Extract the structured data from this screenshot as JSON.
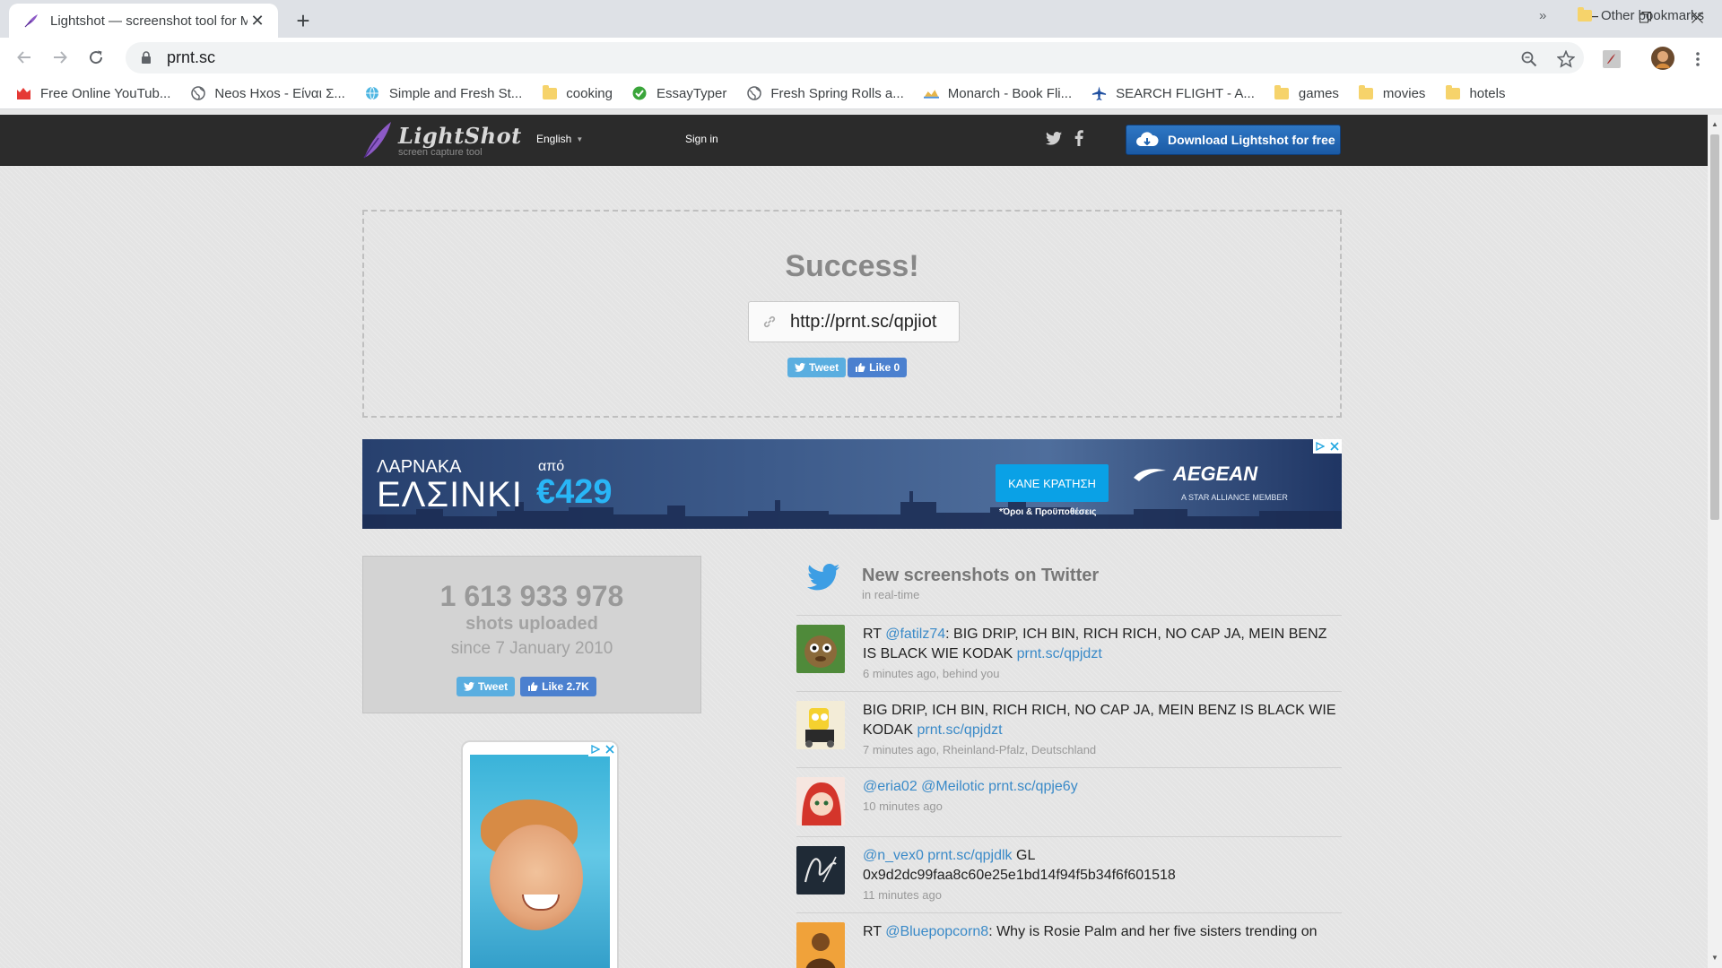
{
  "browser": {
    "tab_title": "Lightshot — screenshot tool for Mac & Win",
    "url": "prnt.sc",
    "bookmarks": [
      {
        "label": "Free Online YouTub...",
        "icon": "youtube-mp3-icon"
      },
      {
        "label": "Neos Hxos - Είναι Σ...",
        "icon": "globe-icon"
      },
      {
        "label": "Simple and Fresh St...",
        "icon": "globe-blue-icon"
      },
      {
        "label": "cooking",
        "icon": "folder-icon"
      },
      {
        "label": "EssayTyper",
        "icon": "check-circle-icon"
      },
      {
        "label": "Fresh Spring Rolls a...",
        "icon": "globe-icon"
      },
      {
        "label": "Monarch - Book Fli...",
        "icon": "monarch-icon"
      },
      {
        "label": "SEARCH FLIGHT - A...",
        "icon": "plane-icon"
      },
      {
        "label": "games",
        "icon": "folder-icon"
      },
      {
        "label": "movies",
        "icon": "folder-icon"
      },
      {
        "label": "hotels",
        "icon": "folder-icon"
      }
    ],
    "bookmarks_more": "»",
    "other_bookmarks": "Other bookmarks"
  },
  "header": {
    "logo_name": "LightShot",
    "logo_tagline": "screen capture tool",
    "language": "English",
    "signin": "Sign in",
    "download": "Download Lightshot for free"
  },
  "upload": {
    "title": "Success!",
    "link": "http://prnt.sc/qpjiot",
    "tweet": "Tweet",
    "like": "Like 0"
  },
  "ad": {
    "from_city": "ΛΑΡΝΑΚΑ",
    "to_city": "ΕΛΣΙΝΚΙ",
    "price_prefix": "από",
    "price": "€429",
    "cta": "ΚΑΝΕ ΚΡΑΤΗΣΗ",
    "terms": "*Όροι & Προϋποθέσεις",
    "brand": "AEGEAN",
    "alliance": "A STAR ALLIANCE MEMBER"
  },
  "stats": {
    "count": "1 613 933 978",
    "label": "shots uploaded",
    "since": "since 7 January 2010",
    "tweet": "Tweet",
    "like": "Like 2.7K"
  },
  "feed": {
    "title": "New screenshots on Twitter",
    "subtitle": "in real-time",
    "tweets": [
      {
        "prefix": "RT ",
        "mention": "@fatilz74",
        "text": ": BIG DRIP, ICH BIN, RICH RICH, NO CAP JA, MEIN BENZ IS BLACK WIE KODAK ",
        "link": "prnt.sc/qpjdzt",
        "meta": "6 minutes ago, behind you"
      },
      {
        "text": "BIG DRIP, ICH BIN, RICH RICH, NO CAP JA, MEIN BENZ IS BLACK WIE KODAK ",
        "link": "prnt.sc/qpjdzt",
        "meta": "7 minutes ago, Rheinland-Pfalz, Deutschland"
      },
      {
        "link": "@eria02 @Meilotic prnt.sc/qpje6y",
        "meta": "10 minutes ago"
      },
      {
        "link": "@n_vex0 prnt.sc/qpjdlk",
        "text": " GL 0x9d2dc99faa8c60e25e1bd14f94f5b34f6f601518",
        "meta": "11 minutes ago"
      },
      {
        "prefix": "RT ",
        "mention": "@Bluepopcorn8",
        "text": ": Why is Rosie Palm and her five sisters trending on"
      }
    ]
  },
  "colors": {
    "header_bg": "#2b2b2b",
    "download_button": "#1f63b0",
    "twitter_blue": "#5aaee0",
    "facebook_blue": "#4b80cf",
    "link_blue": "#3a8ac8"
  }
}
